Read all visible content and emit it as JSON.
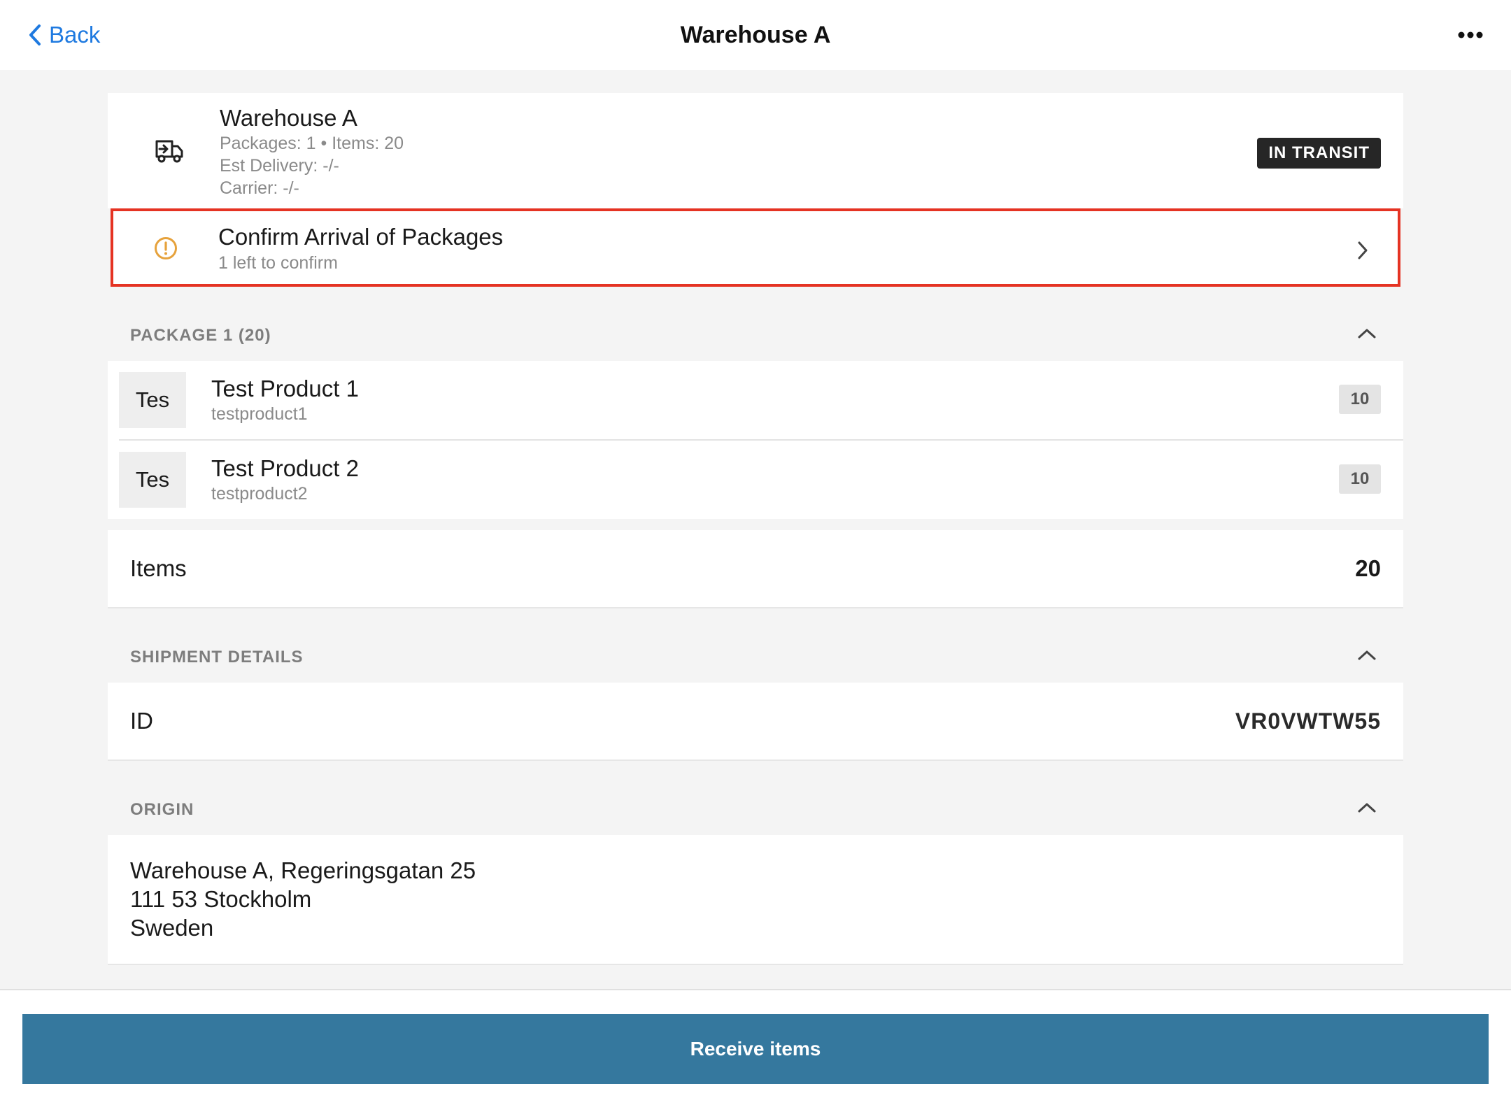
{
  "navbar": {
    "back_label": "Back",
    "title": "Warehouse A",
    "more_icon": "ellipsis-icon"
  },
  "summary": {
    "icon": "truck-icon",
    "title": "Warehouse A",
    "packages_items": "Packages: 1 • Items: 20",
    "est_delivery": "Est Delivery: -/-",
    "carrier": "Carrier: -/-",
    "status_badge": "IN TRANSIT"
  },
  "confirm": {
    "icon": "warning-icon",
    "title": "Confirm Arrival of Packages",
    "subtitle": "1 left to confirm"
  },
  "package_section": {
    "label": "PACKAGE 1 (20)",
    "products": [
      {
        "thumb": "Tes",
        "name": "Test Product 1",
        "sku": "testproduct1",
        "qty": "10"
      },
      {
        "thumb": "Tes",
        "name": "Test Product 2",
        "sku": "testproduct2",
        "qty": "10"
      }
    ]
  },
  "items_total": {
    "label": "Items",
    "value": "20"
  },
  "shipment_details": {
    "label": "SHIPMENT DETAILS",
    "id_label": "ID",
    "id_value": "VR0VWTW55"
  },
  "origin": {
    "label": "ORIGIN",
    "line1": "Warehouse A, Regeringsgatan 25",
    "line2": "111 53 Stockholm",
    "line3": "Sweden"
  },
  "footer": {
    "receive_label": "Receive items"
  },
  "colors": {
    "accent_blue": "#1f7ae0",
    "receive_button": "#35789e",
    "highlight_border": "#e53323",
    "warning": "#e6a23c",
    "badge_bg": "#262626"
  }
}
